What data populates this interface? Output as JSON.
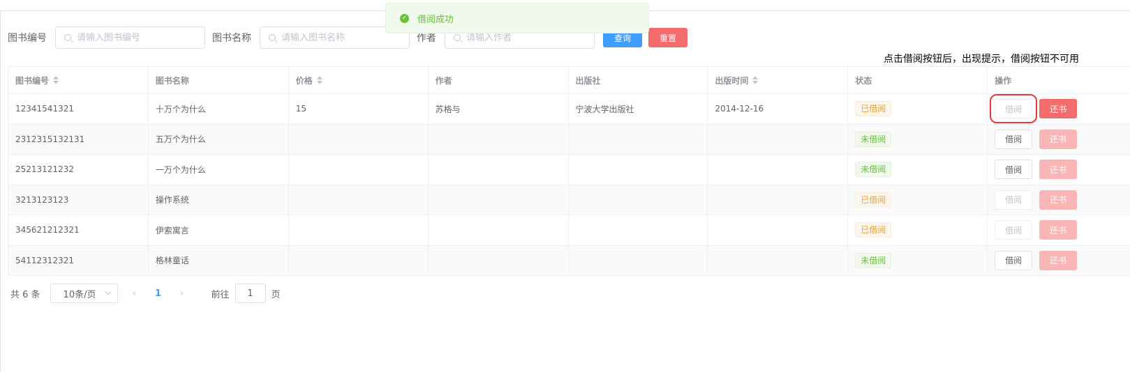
{
  "toast": {
    "message": "借阅成功",
    "icon": "check-circle-icon",
    "color": "#67c23a"
  },
  "search": {
    "fields": [
      {
        "label": "图书编号",
        "placeholder": "请输入图书编号",
        "value": ""
      },
      {
        "label": "图书名称",
        "placeholder": "请输入图书名称",
        "value": ""
      },
      {
        "label": "作者",
        "placeholder": "请输入作者",
        "value": ""
      }
    ],
    "query_label": "查询",
    "reset_label": "重置"
  },
  "note": "点击借阅按钮后，出现提示，借阅按钮不可用",
  "table": {
    "headers": [
      "图书编号",
      "图书名称",
      "价格",
      "作者",
      "出版社",
      "出版时间",
      "状态",
      "操作"
    ],
    "borrow_label": "借阅",
    "return_label": "还书",
    "rows": [
      {
        "id": "12341541321",
        "name": "十万个为什么",
        "price": "15",
        "author": "苏格与",
        "publisher": "宁波大学出版社",
        "date": "2014-12-16",
        "status": "已借阅"
      },
      {
        "id": "2312315132131",
        "name": "五万个为什么",
        "price": "",
        "author": "",
        "publisher": "",
        "date": "",
        "status": "未借阅"
      },
      {
        "id": "25213121232",
        "name": "一万个为什么",
        "price": "",
        "author": "",
        "publisher": "",
        "date": "",
        "status": "未借阅"
      },
      {
        "id": "3213123123",
        "name": "操作系统",
        "price": "",
        "author": "",
        "publisher": "",
        "date": "",
        "status": "已借阅"
      },
      {
        "id": "345621212321",
        "name": "伊索寓言",
        "price": "",
        "author": "",
        "publisher": "",
        "date": "",
        "status": "已借阅"
      },
      {
        "id": "54112312321",
        "name": "格林童话",
        "price": "",
        "author": "",
        "publisher": "",
        "date": "",
        "status": "未借阅"
      }
    ]
  },
  "pagination": {
    "total": "共 6 条",
    "page_size": "10条/页",
    "current": "1",
    "goto_label": "前往",
    "goto_value": "1",
    "page_suffix": "页"
  }
}
